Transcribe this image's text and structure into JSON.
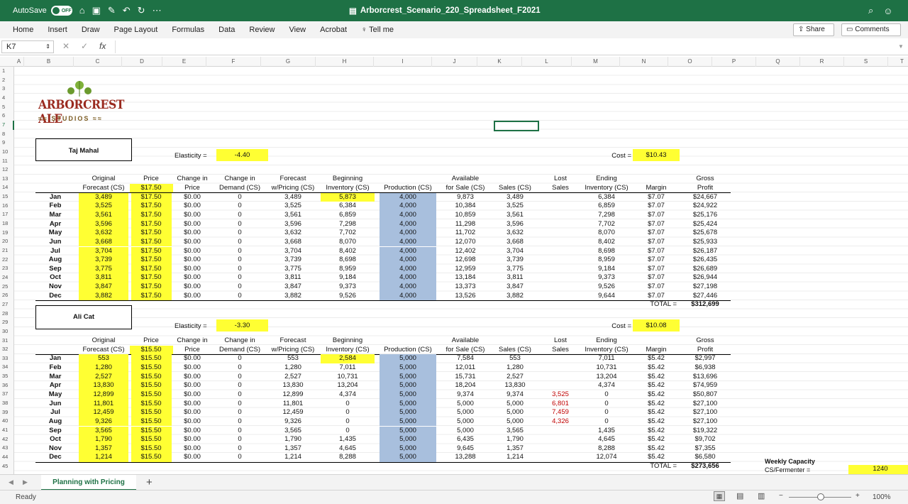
{
  "app": {
    "autosave_label": "AutoSave",
    "autosave_state": "OFF",
    "title": "Arborcrest_Scenario_220_Spreadsheet_F2021"
  },
  "ribbon": {
    "tabs": [
      "Home",
      "Insert",
      "Draw",
      "Page Layout",
      "Formulas",
      "Data",
      "Review",
      "View",
      "Acrobat"
    ],
    "tell_me": "Tell me",
    "share": "Share",
    "comments": "Comments"
  },
  "formula_bar": {
    "name_box": "K7",
    "fx": "fx",
    "value": ""
  },
  "columns": [
    "A",
    "B",
    "C",
    "D",
    "E",
    "F",
    "G",
    "H",
    "I",
    "J",
    "K",
    "L",
    "M",
    "N",
    "O",
    "P",
    "Q",
    "R",
    "S",
    "T"
  ],
  "logo": {
    "line1": "ARBORCREST ALE",
    "line2": "STUDIOS"
  },
  "section1": {
    "product": "Taj Mahal",
    "elasticity_label": "Elasticity =",
    "elasticity": "-4.40",
    "cost_label": "Cost =",
    "cost": "$10.43",
    "headers": [
      [
        "",
        "Original",
        "Price",
        "Change in",
        "Change in",
        "Forecast",
        "Beginning",
        "",
        "Available",
        "",
        "Lost",
        "Ending",
        "",
        "Gross"
      ],
      [
        "",
        "Forecast (CS)",
        "$17.50",
        "Price",
        "Demand (CS)",
        "w/Pricing (CS)",
        "Inventory (CS)",
        "Production (CS)",
        "for Sale (CS)",
        "Sales (CS)",
        "Sales",
        "Inventory (CS)",
        "Margin",
        "Profit"
      ]
    ],
    "rows": [
      [
        "Jan",
        "3,489",
        "$17.50",
        "$0.00",
        "0",
        "3,489",
        "5,873",
        "4,000",
        "9,873",
        "3,489",
        "",
        "6,384",
        "$7.07",
        "$24,667"
      ],
      [
        "Feb",
        "3,525",
        "$17.50",
        "$0.00",
        "0",
        "3,525",
        "6,384",
        "4,000",
        "10,384",
        "3,525",
        "",
        "6,859",
        "$7.07",
        "$24,922"
      ],
      [
        "Mar",
        "3,561",
        "$17.50",
        "$0.00",
        "0",
        "3,561",
        "6,859",
        "4,000",
        "10,859",
        "3,561",
        "",
        "7,298",
        "$7.07",
        "$25,176"
      ],
      [
        "Apr",
        "3,596",
        "$17.50",
        "$0.00",
        "0",
        "3,596",
        "7,298",
        "4,000",
        "11,298",
        "3,596",
        "",
        "7,702",
        "$7.07",
        "$25,424"
      ],
      [
        "May",
        "3,632",
        "$17.50",
        "$0.00",
        "0",
        "3,632",
        "7,702",
        "4,000",
        "11,702",
        "3,632",
        "",
        "8,070",
        "$7.07",
        "$25,678"
      ],
      [
        "Jun",
        "3,668",
        "$17.50",
        "$0.00",
        "0",
        "3,668",
        "8,070",
        "4,000",
        "12,070",
        "3,668",
        "",
        "8,402",
        "$7.07",
        "$25,933"
      ],
      [
        "Jul",
        "3,704",
        "$17.50",
        "$0.00",
        "0",
        "3,704",
        "8,402",
        "4,000",
        "12,402",
        "3,704",
        "",
        "8,698",
        "$7.07",
        "$26,187"
      ],
      [
        "Aug",
        "3,739",
        "$17.50",
        "$0.00",
        "0",
        "3,739",
        "8,698",
        "4,000",
        "12,698",
        "3,739",
        "",
        "8,959",
        "$7.07",
        "$26,435"
      ],
      [
        "Sep",
        "3,775",
        "$17.50",
        "$0.00",
        "0",
        "3,775",
        "8,959",
        "4,000",
        "12,959",
        "3,775",
        "",
        "9,184",
        "$7.07",
        "$26,689"
      ],
      [
        "Oct",
        "3,811",
        "$17.50",
        "$0.00",
        "0",
        "3,811",
        "9,184",
        "4,000",
        "13,184",
        "3,811",
        "",
        "9,373",
        "$7.07",
        "$26,944"
      ],
      [
        "Nov",
        "3,847",
        "$17.50",
        "$0.00",
        "0",
        "3,847",
        "9,373",
        "4,000",
        "13,373",
        "3,847",
        "",
        "9,526",
        "$7.07",
        "$27,198"
      ],
      [
        "Dec",
        "3,882",
        "$17.50",
        "$0.00",
        "0",
        "3,882",
        "9,526",
        "4,000",
        "13,526",
        "3,882",
        "",
        "9,644",
        "$7.07",
        "$27,446"
      ]
    ],
    "total_label": "TOTAL =",
    "total": "$312,699"
  },
  "section2": {
    "product": "Ali Cat",
    "elasticity_label": "Elasticity =",
    "elasticity": "-3.30",
    "cost_label": "Cost =",
    "cost": "$10.08",
    "headers": [
      [
        "",
        "Original",
        "Price",
        "Change in",
        "Change in",
        "Forecast",
        "Beginning",
        "",
        "Available",
        "",
        "Lost",
        "Ending",
        "",
        "Gross"
      ],
      [
        "",
        "Forecast (CS)",
        "$15.50",
        "Price",
        "Demand (CS)",
        "w/Pricing (CS)",
        "Inventory (CS)",
        "Production (CS)",
        "for Sale (CS)",
        "Sales (CS)",
        "Sales",
        "Inventory (CS)",
        "Margin",
        "Profit"
      ]
    ],
    "rows": [
      [
        "Jan",
        "553",
        "$15.50",
        "$0.00",
        "0",
        "553",
        "2,584",
        "5,000",
        "7,584",
        "553",
        "",
        "7,011",
        "$5.42",
        "$2,997"
      ],
      [
        "Feb",
        "1,280",
        "$15.50",
        "$0.00",
        "0",
        "1,280",
        "7,011",
        "5,000",
        "12,011",
        "1,280",
        "",
        "10,731",
        "$5.42",
        "$6,938"
      ],
      [
        "Mar",
        "2,527",
        "$15.50",
        "$0.00",
        "0",
        "2,527",
        "10,731",
        "5,000",
        "15,731",
        "2,527",
        "",
        "13,204",
        "$5.42",
        "$13,696"
      ],
      [
        "Apr",
        "13,830",
        "$15.50",
        "$0.00",
        "0",
        "13,830",
        "13,204",
        "5,000",
        "18,204",
        "13,830",
        "",
        "4,374",
        "$5.42",
        "$74,959"
      ],
      [
        "May",
        "12,899",
        "$15.50",
        "$0.00",
        "0",
        "12,899",
        "4,374",
        "5,000",
        "9,374",
        "9,374",
        "3,525",
        "0",
        "$5.42",
        "$50,807"
      ],
      [
        "Jun",
        "11,801",
        "$15.50",
        "$0.00",
        "0",
        "11,801",
        "0",
        "5,000",
        "5,000",
        "5,000",
        "6,801",
        "0",
        "$5.42",
        "$27,100"
      ],
      [
        "Jul",
        "12,459",
        "$15.50",
        "$0.00",
        "0",
        "12,459",
        "0",
        "5,000",
        "5,000",
        "5,000",
        "7,459",
        "0",
        "$5.42",
        "$27,100"
      ],
      [
        "Aug",
        "9,326",
        "$15.50",
        "$0.00",
        "0",
        "9,326",
        "0",
        "5,000",
        "5,000",
        "5,000",
        "4,326",
        "0",
        "$5.42",
        "$27,100"
      ],
      [
        "Sep",
        "3,565",
        "$15.50",
        "$0.00",
        "0",
        "3,565",
        "0",
        "5,000",
        "5,000",
        "3,565",
        "",
        "1,435",
        "$5.42",
        "$19,322"
      ],
      [
        "Oct",
        "1,790",
        "$15.50",
        "$0.00",
        "0",
        "1,790",
        "1,435",
        "5,000",
        "6,435",
        "1,790",
        "",
        "4,645",
        "$5.42",
        "$9,702"
      ],
      [
        "Nov",
        "1,357",
        "$15.50",
        "$0.00",
        "0",
        "1,357",
        "4,645",
        "5,000",
        "9,645",
        "1,357",
        "",
        "8,288",
        "$5.42",
        "$7,355"
      ],
      [
        "Dec",
        "1,214",
        "$15.50",
        "$0.00",
        "0",
        "1,214",
        "8,288",
        "5,000",
        "13,288",
        "1,214",
        "",
        "12,074",
        "$5.42",
        "$6,580"
      ]
    ],
    "total_label": "TOTAL =",
    "total": "$273,656"
  },
  "capacity": {
    "label": "Weekly Capacity",
    "sub_label": "CS/Fermenter =",
    "value": "1240"
  },
  "sheet_tab": "Planning with Pricing",
  "status": {
    "ready": "Ready",
    "zoom": "100%"
  },
  "colors": {
    "excel_green": "#1e7145",
    "highlight_yellow": "#ffff33",
    "production_blue": "#a8bfdd",
    "lost_sales_red": "#c00000"
  }
}
